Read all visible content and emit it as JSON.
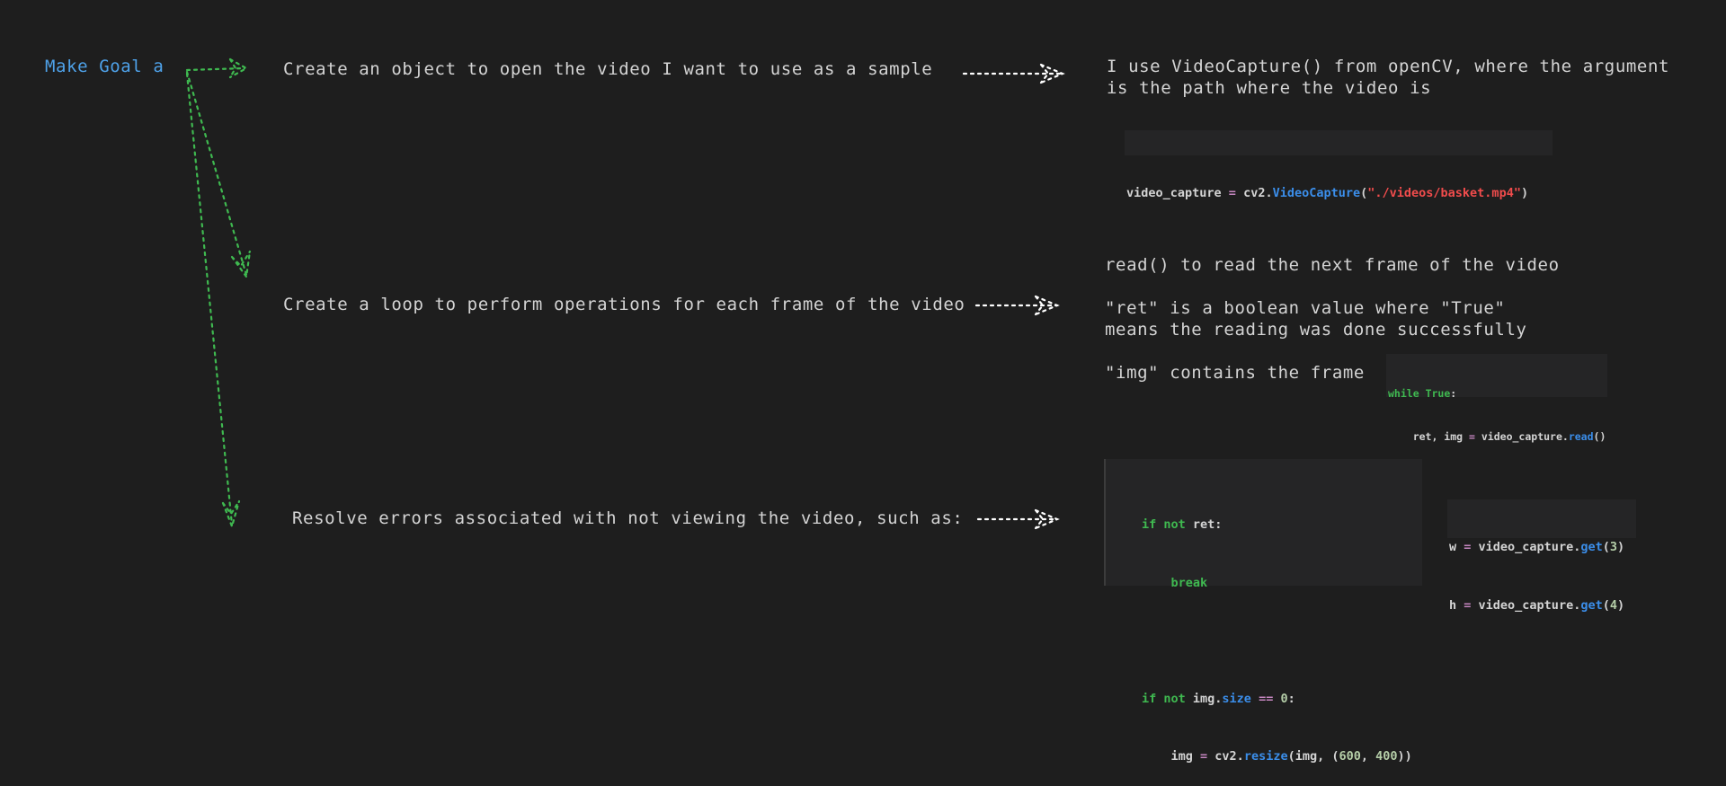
{
  "goal_label": "Make Goal a",
  "steps": [
    {
      "title": "Create an object to open the video I want to use as a sample",
      "notes": [
        "I use VideoCapture() from openCV, where the argument",
        "is the path where the video is"
      ],
      "code": {
        "line1": {
          "a": "video_capture ",
          "b": "=",
          "c": " cv2.",
          "d": "VideoCapture",
          "e": "(",
          "f": "\"./videos/basket.mp4\"",
          "g": ")"
        }
      }
    },
    {
      "title": "Create a loop to perform operations for each frame of the video",
      "notes": [
        "read() to read the next frame of the video",
        "\"ret\" is a boolean value where \"True\"",
        "means the reading was done successfully",
        "\"img\" contains the frame"
      ],
      "code": {
        "line1": {
          "a": "while",
          "b": " ",
          "c": "True",
          "d": ":"
        },
        "line2": {
          "a": "    ret, img ",
          "b": "=",
          "c": " video_capture.",
          "d": "read",
          "e": "()"
        }
      }
    },
    {
      "title": "Resolve errors associated with not viewing the video, such as:",
      "code": {
        "l1": {
          "a": "if",
          "b": " not",
          "c": " ret:"
        },
        "l2": {
          "a": "    break"
        },
        "l3": {
          "a": "if",
          "b": " not",
          "c": " img.",
          "d": "size",
          "e": " ",
          "f": "==",
          "g": " ",
          "h": "0",
          "i": ":"
        },
        "l4": {
          "a": "    img ",
          "b": "=",
          "c": " cv2.",
          "d": "resize",
          "e": "(img, (",
          "f": "600",
          "g": ", ",
          "h": "400",
          "i": "))"
        },
        "w": {
          "a": "w ",
          "b": "=",
          "c": " video_capture.",
          "d": "get",
          "e": "(",
          "f": "3",
          "g": ")"
        },
        "h": {
          "a": "h ",
          "b": "=",
          "c": " video_capture.",
          "d": "get",
          "e": "(",
          "f": "4",
          "g": ")"
        }
      }
    }
  ],
  "colors": {
    "background": "#1e1e1e",
    "goal": "#4ea1e8",
    "green_arrow": "#3fb950",
    "white_arrow": "#ffffff",
    "code_bg": "#252526"
  }
}
